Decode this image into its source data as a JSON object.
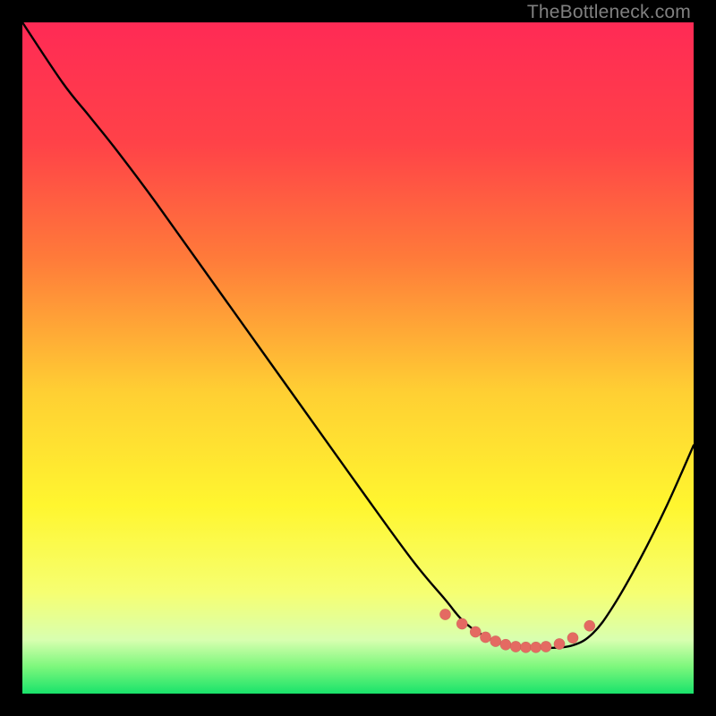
{
  "watermark": "TheBottleneck.com",
  "chart_data": {
    "type": "line",
    "title": "",
    "xlabel": "",
    "ylabel": "",
    "xlim": [
      0,
      100
    ],
    "ylim": [
      0,
      100
    ],
    "gradient_stops": [
      {
        "offset": 0,
        "color": "#ff2a55"
      },
      {
        "offset": 18,
        "color": "#ff4248"
      },
      {
        "offset": 35,
        "color": "#ff7a3a"
      },
      {
        "offset": 55,
        "color": "#ffcf33"
      },
      {
        "offset": 72,
        "color": "#fff62f"
      },
      {
        "offset": 85,
        "color": "#f6ff72"
      },
      {
        "offset": 92,
        "color": "#d8ffb0"
      },
      {
        "offset": 96,
        "color": "#7cf77c"
      },
      {
        "offset": 100,
        "color": "#19e36b"
      }
    ],
    "green_band": {
      "from_y": 93,
      "to_y": 100
    },
    "series": [
      {
        "name": "bottleneck-curve",
        "x": [
          0,
          6,
          10,
          14,
          20,
          30,
          40,
          50,
          58,
          63,
          66,
          70,
          74,
          78,
          82,
          85,
          88,
          92,
          96,
          100
        ],
        "y": [
          0,
          9,
          14,
          19,
          27,
          41,
          55,
          69,
          80,
          86,
          89.5,
          92,
          93,
          93.2,
          92.8,
          91,
          87,
          80,
          72,
          63
        ]
      }
    ],
    "markers": {
      "name": "optimal-range",
      "x": [
        63,
        65.5,
        67.5,
        69,
        70.5,
        72,
        73.5,
        75,
        76.5,
        78,
        80,
        82,
        84.5
      ],
      "y": [
        88.2,
        89.6,
        90.8,
        91.6,
        92.2,
        92.7,
        93.0,
        93.1,
        93.1,
        93.0,
        92.6,
        91.7,
        89.9
      ]
    }
  }
}
